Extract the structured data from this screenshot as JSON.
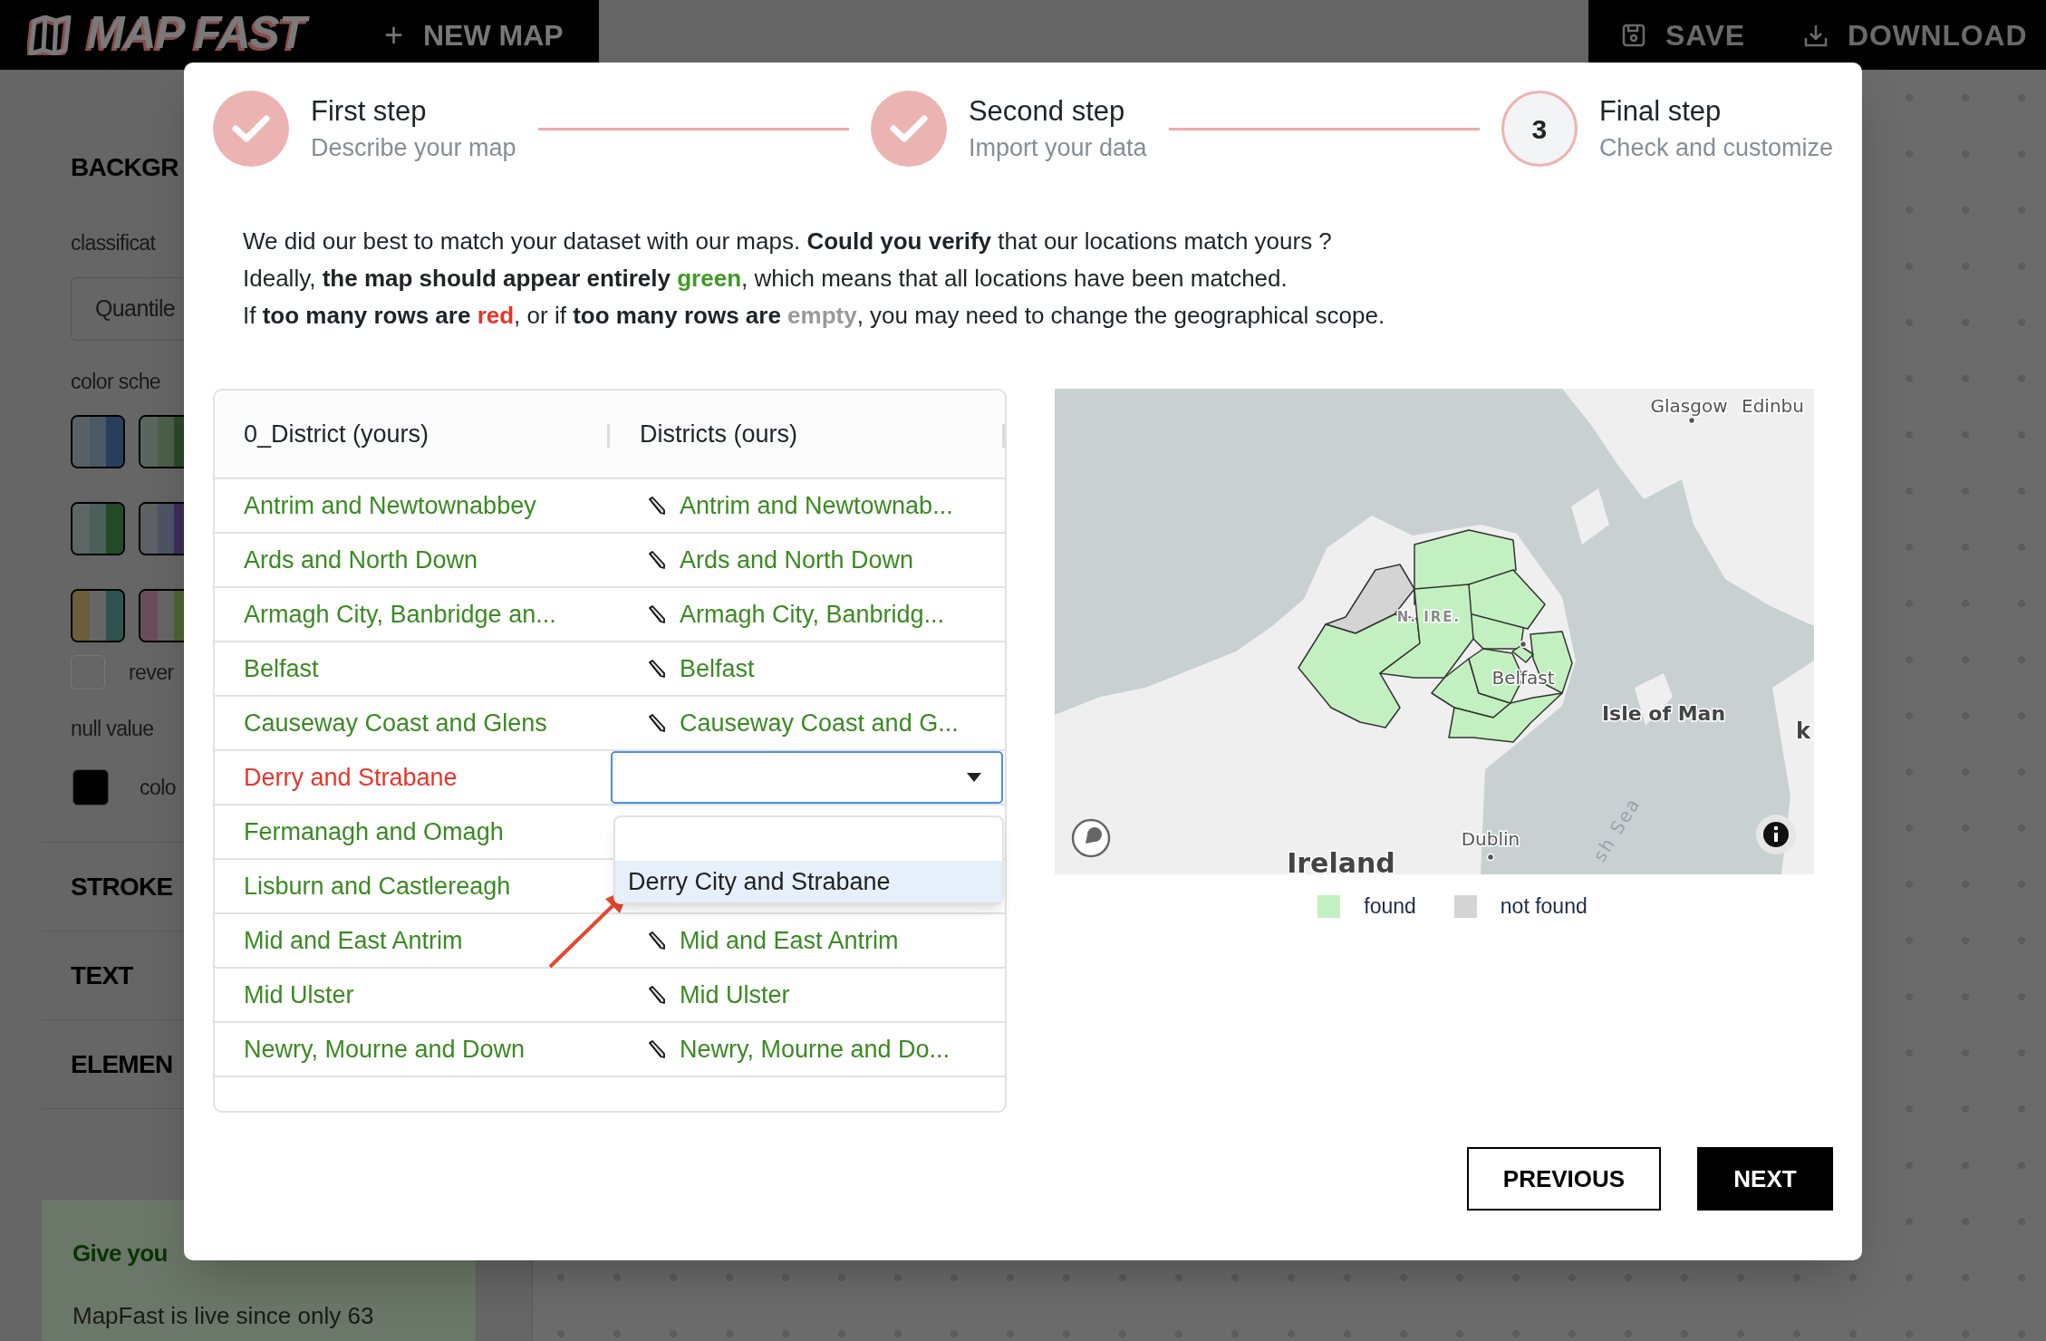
{
  "header": {
    "logo": "MAP FAST",
    "new_map": {
      "icon": "+",
      "label": "NEW MAP"
    },
    "actions": [
      {
        "label": "SAVE"
      },
      {
        "label": "DOWNLOAD"
      }
    ]
  },
  "sidebar": {
    "section_title": "BACKGR",
    "classification_label": "classificat",
    "classification_value": "Quantile",
    "color_scheme_label": "color sche",
    "reverse": {
      "label": "rever",
      "checked": false
    },
    "null_label": "null value",
    "null_color": {
      "label": "colo",
      "color": "#000000"
    },
    "sections": [
      "STROKE",
      "TEXT",
      "ELEMEN"
    ],
    "feedback": {
      "title": "Give you",
      "text": "MapFast is live since only 63"
    }
  },
  "wizard": {
    "steps": [
      {
        "title": "First step",
        "subtitle": "Describe your map",
        "done": true
      },
      {
        "title": "Second step",
        "subtitle": "Import your data",
        "done": true
      },
      {
        "title": "Final step",
        "subtitle": "Check and customize",
        "done": false,
        "number": "3"
      }
    ],
    "intro": [
      [
        {
          "text": "We did our best to match your dataset with our maps. "
        },
        {
          "text": "Could you verify",
          "bold": true
        },
        {
          "text": " that our locations match yours ?"
        }
      ],
      [
        {
          "text": "Ideally, "
        },
        {
          "text": "the map should appear entirely ",
          "bold": true
        },
        {
          "text": "green",
          "bold": true,
          "color": "#3f9a24"
        },
        {
          "text": ", which means that all locations have been matched."
        }
      ],
      [
        {
          "text": "If "
        },
        {
          "text": "too many rows are ",
          "bold": true
        },
        {
          "text": "red",
          "bold": true,
          "color": "#e8352a"
        },
        {
          "text": ", or if "
        },
        {
          "text": "too many rows are ",
          "bold": true
        },
        {
          "text": "empty",
          "bold": true,
          "color": "#9a9a9a"
        },
        {
          "text": ", you may need to change the geographical scope."
        }
      ]
    ],
    "table": {
      "columns": [
        "0_District (yours)",
        "Districts (ours)"
      ],
      "rows": [
        {
          "yours": "Antrim and Newtownabbey",
          "matched": true,
          "match": "Antrim and Newtownab..."
        },
        {
          "yours": "Ards and North Down",
          "matched": true,
          "match": "Ards and North Down"
        },
        {
          "yours": "Armagh City, Banbridge an...",
          "matched": true,
          "match": "Armagh City, Banbridg..."
        },
        {
          "yours": "Belfast",
          "matched": true,
          "match": "Belfast"
        },
        {
          "yours": "Causeway Coast and Glens",
          "matched": true,
          "match": "Causeway Coast and G..."
        },
        {
          "yours": "Derry and Strabane",
          "matched": false,
          "dropdown": {
            "open": true,
            "options": [
              {
                "label": "Derry City and Strabane",
                "highlighted": true
              }
            ]
          }
        },
        {
          "yours": "Fermanagh and Omagh",
          "matched": true
        },
        {
          "yours": "Lisburn and Castlereagh",
          "matched": true
        },
        {
          "yours": "Mid and East Antrim",
          "matched": true,
          "match": "Mid and East Antrim"
        },
        {
          "yours": "Mid Ulster",
          "matched": true,
          "match": "Mid Ulster"
        },
        {
          "yours": "Newry, Mourne and Down",
          "matched": true,
          "match": "Newry, Mourne and Do..."
        }
      ]
    },
    "map": {
      "labels": [
        {
          "text": "Glasgow",
          "kind": "city"
        },
        {
          "text": "Edinbu",
          "kind": "place"
        },
        {
          "text": "N. IRE.",
          "kind": "region"
        },
        {
          "text": "Belfast",
          "kind": "city"
        },
        {
          "text": "Isle of Man",
          "kind": "island"
        },
        {
          "text": "Dublin",
          "kind": "city"
        },
        {
          "text": "Ireland",
          "kind": "country"
        },
        {
          "text": "sh Sea",
          "kind": "sea"
        },
        {
          "text": "k",
          "kind": "island"
        }
      ],
      "legend": [
        {
          "label": "found",
          "color": "#c3f0c0"
        },
        {
          "label": "not found",
          "color": "#d4d4d4"
        }
      ]
    },
    "buttons": [
      {
        "label": "PREVIOUS",
        "kind": "outline"
      },
      {
        "label": "NEXT",
        "kind": "primary"
      }
    ]
  }
}
